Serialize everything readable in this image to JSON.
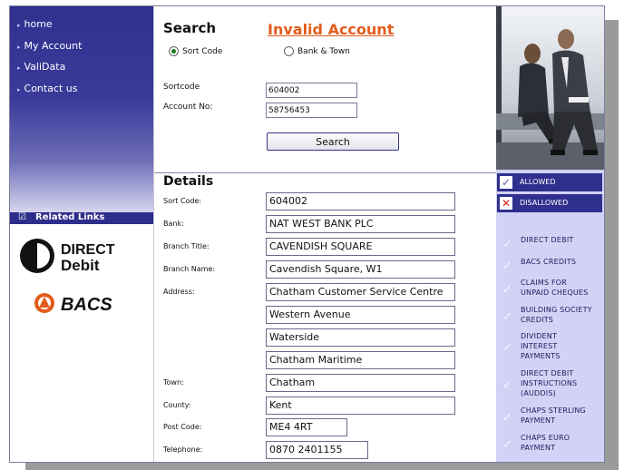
{
  "nav": {
    "items": [
      {
        "label": "home"
      },
      {
        "label": "My Account"
      },
      {
        "label": "ValiData"
      },
      {
        "label": "Contact us"
      }
    ],
    "related_label": "Related Links"
  },
  "logos": {
    "direct_debit": {
      "line1": "DIRECT",
      "line2": "Debit"
    },
    "bacs": "BACS"
  },
  "search": {
    "title": "Search",
    "status": "Invalid Account",
    "radio_sort_code": "Sort Code",
    "radio_bank_town": "Bank & Town",
    "selected": "Sort Code",
    "sortcode_label": "Sortcode",
    "sortcode_value": "604002",
    "account_label": "Account No:",
    "account_value": "58756453",
    "button_label": "Search"
  },
  "details": {
    "title": "Details",
    "fields": [
      {
        "label": "Sort Code:",
        "value": "604002"
      },
      {
        "label": "Bank:",
        "value": "NAT WEST BANK PLC"
      },
      {
        "label": "Branch Title:",
        "value": "CAVENDISH SQUARE"
      },
      {
        "label": "Branch Name:",
        "value": "Cavendish Square, W1"
      },
      {
        "label": "Address:",
        "value": "Chatham Customer Service Centre"
      },
      {
        "label": "",
        "value": "Western Avenue"
      },
      {
        "label": "",
        "value": "Waterside"
      },
      {
        "label": "",
        "value": "Chatham Maritime"
      },
      {
        "label": "Town:",
        "value": "Chatham"
      },
      {
        "label": "County:",
        "value": "Kent"
      },
      {
        "label": "Post Code:",
        "value": "ME4 4RT"
      },
      {
        "label": "Telephone:",
        "value": "0870  2401155"
      }
    ]
  },
  "legend": {
    "allowed": "ALLOWED",
    "disallowed": "DISALLOWED"
  },
  "services": [
    {
      "lines": [
        "DIRECT DEBIT"
      ],
      "status": "allowed"
    },
    {
      "lines": [
        "BACS CREDITS"
      ],
      "status": "allowed"
    },
    {
      "lines": [
        "CLAIMS FOR",
        "UNPAID CHEQUES"
      ],
      "status": "allowed"
    },
    {
      "lines": [
        "BUILDING SOCIETY",
        "CREDITS"
      ],
      "status": "allowed"
    },
    {
      "lines": [
        "DIVIDENT",
        "INTEREST",
        "PAYMENTS"
      ],
      "status": "allowed"
    },
    {
      "lines": [
        "DIRECT DEBIT",
        "INSTRUCTIONS",
        "(AUDDIS)"
      ],
      "status": "allowed"
    },
    {
      "lines": [
        "CHAPS STERLING",
        "PAYMENT"
      ],
      "status": "allowed"
    },
    {
      "lines": [
        "CHAPS EURO",
        "PAYMENT"
      ],
      "status": "allowed"
    }
  ],
  "colors": {
    "nav_bg": "#30308f",
    "status_invalid": "#e35c1c",
    "panel_bg": "#d2d2f6",
    "allowed_tick": "#f4f4ff",
    "disallowed_x": "#e02020"
  }
}
